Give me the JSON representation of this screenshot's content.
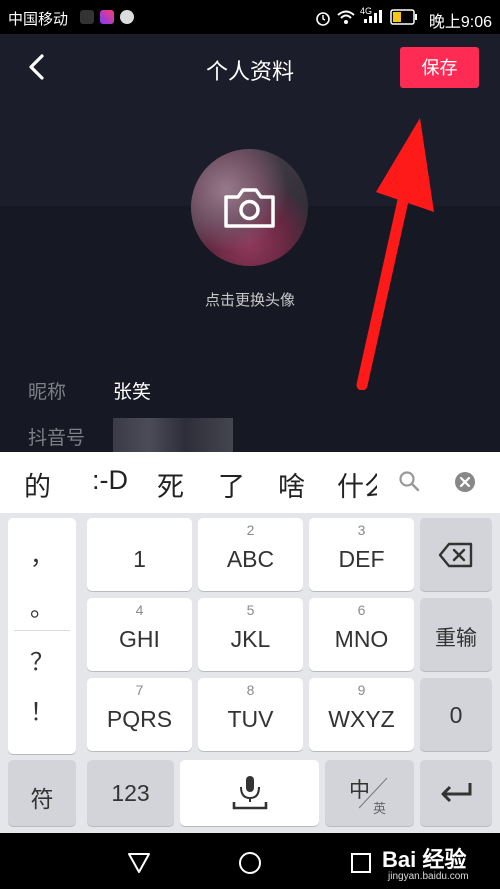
{
  "status_bar": {
    "carrier": "中国移动",
    "time": "晚上9:06",
    "signal": "4G"
  },
  "header": {
    "title": "个人资料",
    "save_label": "保存"
  },
  "avatar": {
    "hint": "点击更换头像"
  },
  "profile": {
    "nickname_label": "昵称",
    "nickname_value": "张笑",
    "douyin_id_label": "抖音号"
  },
  "candidates": [
    "的",
    ":-D",
    "死",
    "了",
    "啥",
    "什么"
  ],
  "keyboard": {
    "side_punct": [
      "，",
      "。",
      "？",
      "！"
    ],
    "rows": [
      [
        {
          "num": "",
          "label": "1"
        },
        {
          "num": "2",
          "label": "ABC"
        },
        {
          "num": "3",
          "label": "DEF"
        }
      ],
      [
        {
          "num": "4",
          "label": "GHI"
        },
        {
          "num": "5",
          "label": "JKL"
        },
        {
          "num": "6",
          "label": "MNO"
        }
      ],
      [
        {
          "num": "7",
          "label": "PQRS"
        },
        {
          "num": "8",
          "label": "TUV"
        },
        {
          "num": "9",
          "label": "WXYZ"
        }
      ]
    ],
    "reinput_label": "重输",
    "zero_label": "0",
    "symbol_label": "符",
    "numeric_label": "123",
    "lang_main": "中",
    "lang_sub": "英"
  },
  "watermark": {
    "text": "Bai 经验",
    "sub": "jingyan.baidu.com"
  },
  "colors": {
    "accent": "#fe2c55",
    "background": "#161823",
    "arrow": "#ff1a1a"
  }
}
